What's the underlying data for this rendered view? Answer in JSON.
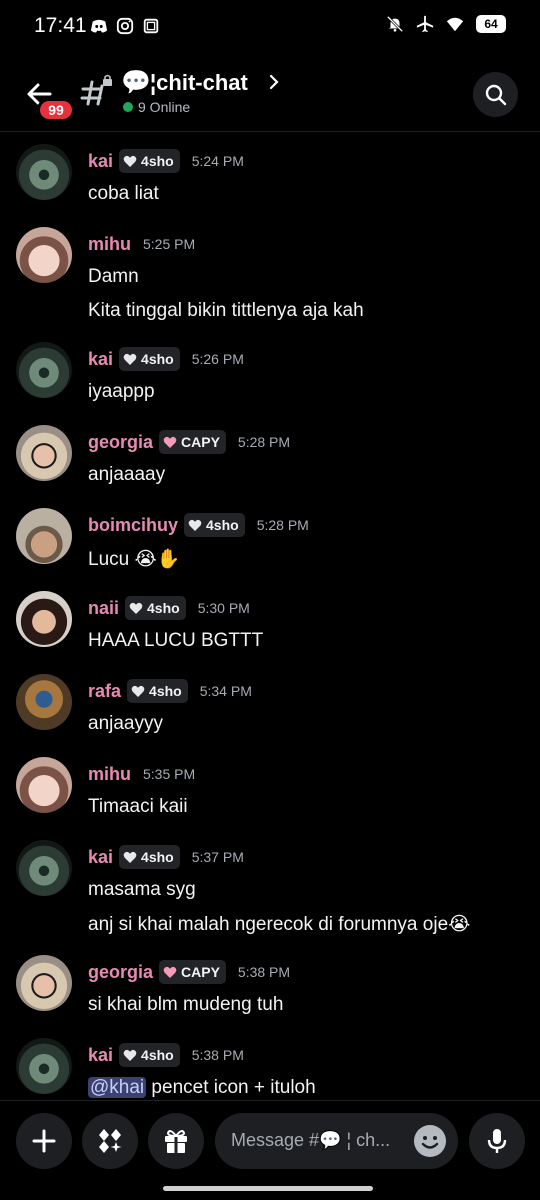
{
  "status_bar": {
    "time": "17:41",
    "battery": "64"
  },
  "header": {
    "unread_badge": "99",
    "channel_emoji": "💬",
    "channel_name": "¦chit-chat",
    "online_text": "9 Online"
  },
  "messages": [
    {
      "user": "kai",
      "tag": "4sho",
      "tag_heart": "white",
      "time": "5:24 PM",
      "lines": [
        "coba liat"
      ]
    },
    {
      "user": "mihu",
      "tag": "",
      "time": "5:25 PM",
      "lines": [
        "Damn",
        "Kita tinggal bikin tittlenya aja kah"
      ]
    },
    {
      "user": "kai",
      "tag": "4sho",
      "tag_heart": "white",
      "time": "5:26 PM",
      "lines": [
        "iyaappp"
      ]
    },
    {
      "user": "georgia",
      "tag": "CAPY",
      "tag_heart": "pink",
      "time": "5:28 PM",
      "lines": [
        "anjaaaay"
      ]
    },
    {
      "user": "boimcihuy",
      "tag": "4sho",
      "tag_heart": "white",
      "time": "5:28 PM",
      "lines": [
        "Lucu 😭✋"
      ]
    },
    {
      "user": "naii",
      "tag": "4sho",
      "tag_heart": "white",
      "time": "5:30 PM",
      "lines": [
        "HAAA LUCU BGTTT"
      ]
    },
    {
      "user": "rafa",
      "tag": "4sho",
      "tag_heart": "white",
      "time": "5:34 PM",
      "lines": [
        "anjaayyy"
      ]
    },
    {
      "user": "mihu",
      "tag": "",
      "time": "5:35 PM",
      "lines": [
        "Timaaci kaii"
      ]
    },
    {
      "user": "kai",
      "tag": "4sho",
      "tag_heart": "white",
      "time": "5:37 PM",
      "lines": [
        "masama syg",
        "anj si khai malah ngerecok di forumnya oje😭"
      ]
    },
    {
      "user": "georgia",
      "tag": "CAPY",
      "tag_heart": "pink",
      "time": "5:38 PM",
      "lines": [
        "si khai blm mudeng tuh"
      ]
    },
    {
      "user": "kai",
      "tag": "4sho",
      "tag_heart": "white",
      "time": "5:38 PM",
      "mention": "@khai",
      "lines": [
        " pencet icon + ituloh"
      ]
    }
  ],
  "composer": {
    "placeholder": "Message #💬 ¦ ch..."
  },
  "colors": {
    "username": "#e78ab3",
    "badge": "#e7323d",
    "online": "#23a55a",
    "mention_bg": "#3c4270"
  }
}
